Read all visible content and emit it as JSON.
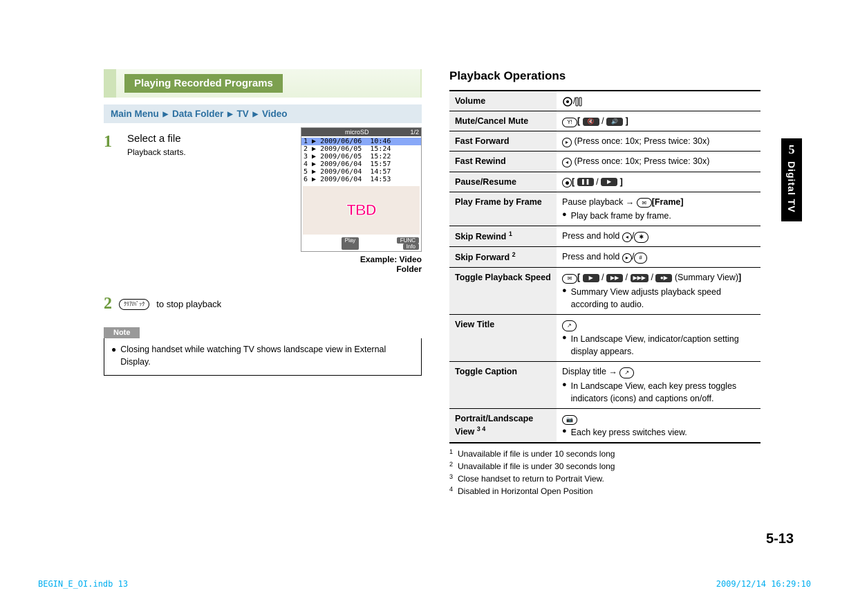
{
  "side": {
    "chapter": "5",
    "label": "Digital TV"
  },
  "page_num": "5-13",
  "foot_left": "BEGIN_E_OI.indb   13",
  "foot_right": "2009/12/14   16:29:10",
  "left": {
    "green_title": "Playing Recorded Programs",
    "blue": {
      "a": "Main Menu",
      "b": "Data Folder",
      "c": "TV",
      "d": "Video",
      "tri": "▶"
    },
    "step1": {
      "num": "1",
      "title": "Select a file",
      "sub": "Playback starts."
    },
    "shot": {
      "top_left": "",
      "top_mid": "microSD",
      "top_right": "1/2",
      "rows": [
        "1 ▶ 2009/06/06  10:46",
        "2 ▶ 2009/06/05  15:24",
        "3 ▶ 2009/06/05  15:22",
        "4 ▶ 2009/06/04  15:57",
        "5 ▶ 2009/06/04  14:57",
        "6 ▶ 2009/06/04  14:53"
      ],
      "thumb_text": "TBD",
      "foot_l": "",
      "foot_m": "Play",
      "foot_r": "FUNC",
      "foot_r2": "Info",
      "caption_a": "Example: Video",
      "caption_b": "Folder"
    },
    "step2": {
      "num": "2",
      "key": "ｸﾘｱ/ﾊﾞｯｸ",
      "text": " to stop playback"
    },
    "note_label": "Note",
    "note": "Closing handset while watching TV shows landscape view in External Display."
  },
  "right": {
    "heading": "Playback Operations",
    "rows": [
      {
        "k": "Volume",
        "type": "volume"
      },
      {
        "k": "Mute/Cancel Mute",
        "type": "mute"
      },
      {
        "k": "Fast Forward",
        "v": "(Press once: 10x; Press twice: 30x)",
        "type": "ff"
      },
      {
        "k": "Fast Rewind",
        "v": "(Press once: 10x; Press twice: 30x)",
        "type": "fr"
      },
      {
        "k": "Pause/Resume",
        "type": "pr"
      },
      {
        "k": "Play Frame by Frame",
        "v1": "Pause playback → ",
        "v1b": "[Frame]",
        "b": "Play back frame by frame."
      },
      {
        "k": "Skip Rewind",
        "sup": "1",
        "v": "Press and hold ",
        "type": "skr"
      },
      {
        "k": "Skip Forward",
        "sup": "2",
        "v": "Press and hold ",
        "type": "skf"
      },
      {
        "k": "Toggle Playback Speed",
        "tail": "(Summary View)",
        "b": "Summary View adjusts playback speed according to audio."
      },
      {
        "k": "View Title",
        "b": "In Landscape View, indicator/caption setting display appears."
      },
      {
        "k": "Toggle Caption",
        "v": "Display title → ",
        "b": "In Landscape View, each key press toggles indicators (icons) and captions on/off."
      },
      {
        "k": "Portrait/Landscape View",
        "sup": "3 4",
        "b": "Each key press switches view."
      }
    ],
    "fns": [
      {
        "n": "1",
        "t": "Unavailable if file is under 10 seconds long"
      },
      {
        "n": "2",
        "t": "Unavailable if file is under 30 seconds long"
      },
      {
        "n": "3",
        "t": "Close handset to return to Portrait View."
      },
      {
        "n": "4",
        "t": "Disabled in Horizontal Open Position"
      }
    ]
  }
}
